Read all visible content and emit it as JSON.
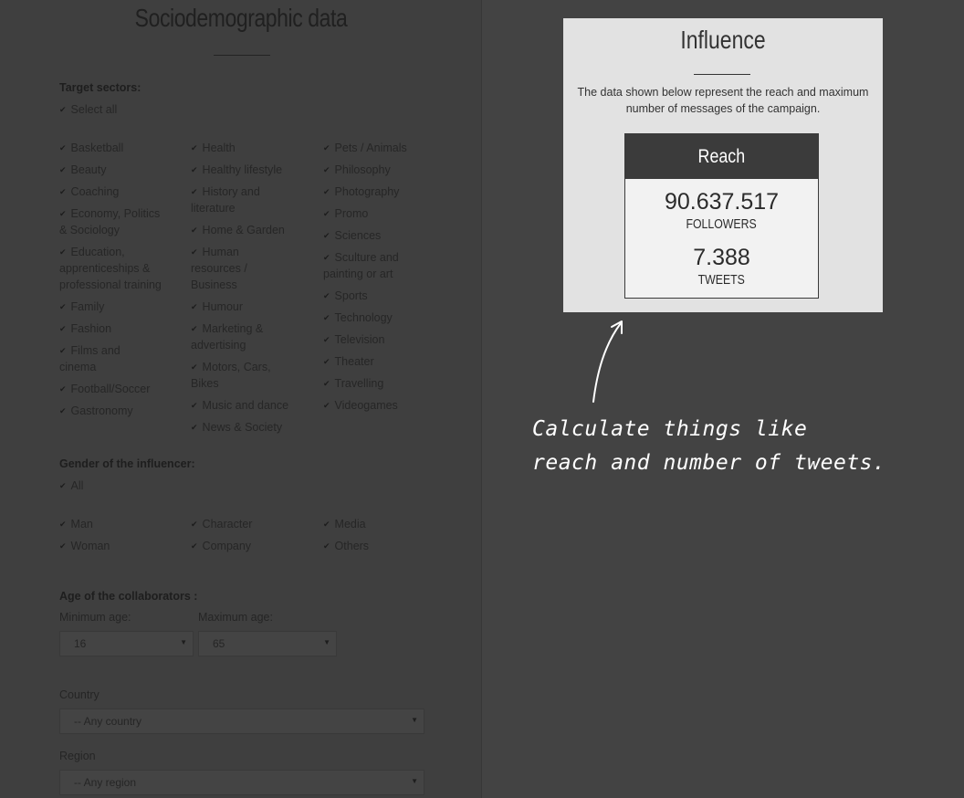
{
  "left": {
    "title": "Sociodemographic data",
    "target_sectors_label": "Target sectors:",
    "select_all": "Select all",
    "sectors_col1": [
      "Basketball",
      "Beauty",
      "Coaching",
      "Economy, Politics",
      "& Sociology",
      "Education,",
      "apprenticeships &",
      "professional training",
      "Family",
      "Fashion",
      "Films and",
      "cinema",
      "Football/Soccer",
      "Gastronomy"
    ],
    "sectors_col2": [
      "Health",
      "Healthy lifestyle",
      "History and",
      "literature",
      "Home & Garden",
      "Human",
      "resources /",
      "Business",
      "Humour",
      "Marketing &",
      "advertising",
      "Motors, Cars,",
      "Bikes",
      "Music and dance",
      "News & Society"
    ],
    "sectors_col3": [
      "Pets / Animals",
      "Philosophy",
      "Photography",
      "Promo",
      "Sciences",
      "Sculture and",
      "painting or art",
      "Sports",
      "Technology",
      "Television",
      "Theater",
      "Travelling",
      "Videogames"
    ],
    "gender_label": "Gender of the influencer:",
    "gender_all": "All",
    "gender_options": [
      "Man",
      "Woman",
      "Character",
      "Company",
      "Media",
      "Others"
    ],
    "age_label": "Age of the collaborators :",
    "min_age_label": "Minimum age:",
    "max_age_label": "Maximum age:",
    "min_age_value": "16",
    "max_age_value": "65",
    "country_label": "Country",
    "country_value": "-- Any country",
    "region_label": "Region",
    "region_value": "-- Any region"
  },
  "card": {
    "title": "Influence",
    "description_line1": "The data shown below represent the reach and maximum",
    "description_line2": "number of messages of the campaign.",
    "reach_header": "Reach",
    "followers_value": "90.637.517",
    "followers_label": "FOLLOWERS",
    "tweets_value": "7.388",
    "tweets_label": "TWEETS"
  },
  "annotation": {
    "line1": "Calculate things like",
    "line2": "reach and number of tweets."
  }
}
